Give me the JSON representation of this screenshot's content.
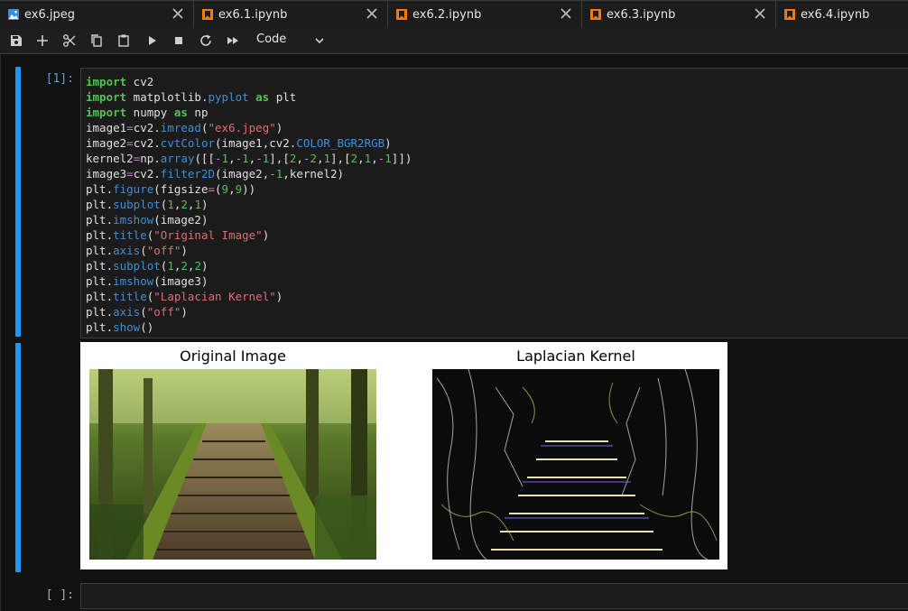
{
  "tabs": [
    {
      "label": "ex6.jpeg",
      "icon": "image-file-icon",
      "active": true
    },
    {
      "label": "ex6.1.ipynb",
      "icon": "notebook-icon"
    },
    {
      "label": "ex6.2.ipynb",
      "icon": "notebook-icon"
    },
    {
      "label": "ex6.3.ipynb",
      "icon": "notebook-icon"
    },
    {
      "label": "ex6.4.ipynb",
      "icon": "notebook-icon"
    }
  ],
  "toolbar": {
    "buttons": [
      "save-icon",
      "add-cell-icon",
      "cut-icon",
      "copy-icon",
      "paste-icon",
      "run-icon",
      "stop-icon",
      "restart-icon",
      "fast-forward-icon"
    ],
    "cell_type": "Code"
  },
  "cells": [
    {
      "prompt": "[1]:",
      "code": [
        "import cv2",
        "import matplotlib.pyplot as plt",
        "import numpy as np",
        "image1=cv2.imread(\"ex6.jpeg\")",
        "image2=cv2.cvtColor(image1,cv2.COLOR_BGR2RGB)",
        "kernel2=np.array([[-1,-1,-1],[2,-2,1],[2,1,-1]])",
        "image3=cv2.filter2D(image2,-1,kernel2)",
        "plt.figure(figsize=(9,9))",
        "plt.subplot(1,2,1)",
        "plt.imshow(image2)",
        "plt.title(\"Original Image\")",
        "plt.axis(\"off\")",
        "plt.subplot(1,2,2)",
        "plt.imshow(image3)",
        "plt.title(\"Laplacian Kernel\")",
        "plt.axis(\"off\")",
        "plt.show()"
      ],
      "output": {
        "titles": [
          "Original Image",
          "Laplacian Kernel"
        ]
      }
    },
    {
      "prompt": "[ ]:"
    }
  ],
  "colors": {
    "accent": "#2196f3",
    "notebook_icon": "#f57c00",
    "image_icon": "#3b8fd9"
  }
}
